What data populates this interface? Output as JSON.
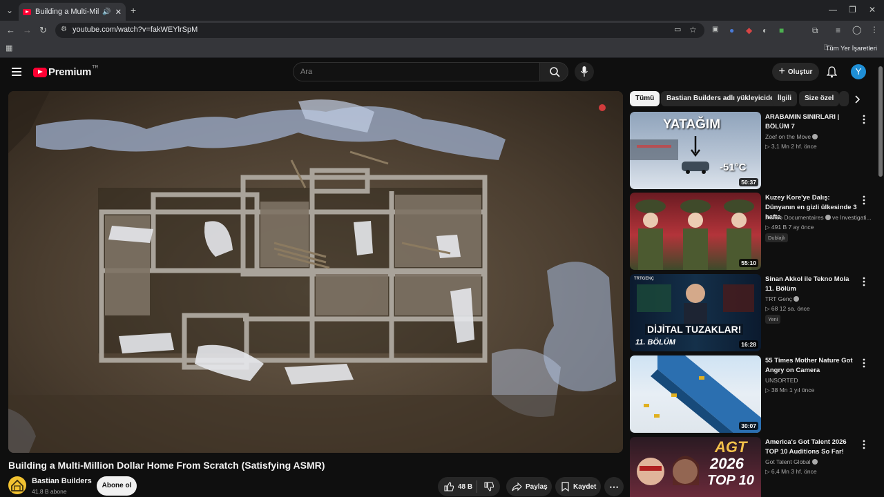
{
  "browser": {
    "tab_title": "Building a Multi-Million Dollar Home",
    "url": "youtube.com/watch?v=fakWEYlrSpM",
    "bookmarks_label": "Tüm Yer İşaretleri"
  },
  "header": {
    "logo_text": "Premium",
    "logo_region": "TR",
    "search_placeholder": "Ara",
    "create_label": "Oluştur",
    "avatar_letter": "Y"
  },
  "video": {
    "title": "Building a Multi-Million Dollar Home From Scratch (Satisfying ASMR)",
    "channel": "Bastian Builders",
    "subscribers": "41,8 B abone",
    "subscribe_label": "Abone ol",
    "likes": "48 B",
    "share_label": "Paylaş",
    "save_label": "Kaydet"
  },
  "chips": [
    "Tümü",
    "Bastian Builders adlı yükleyiciden",
    "İlgili",
    "Size özel"
  ],
  "recommendations": [
    {
      "title": "ARABAMIN SINIRLARI | BÖLÜM 7",
      "channel": "Zoef on the Move",
      "verified": true,
      "meta": "▷ 3,1 Mn  2 hf. önce",
      "badge": "",
      "duration": "50:37",
      "thumb_text_1": "YATAĞIM",
      "thumb_text_2": "-51°C"
    },
    {
      "title": "Kuzey Kore'ye Dalış: Dünyanın en gizli ülkesinde 3 hafta",
      "channel": "imineo Documentaires",
      "verified": true,
      "channel_extra": "ve Investigati...",
      "meta": "▷ 491 B  7 ay önce",
      "badge": "Dublajlı",
      "duration": "55:10"
    },
    {
      "title": "Sinan Akkol ile Tekno Mola 11. Bölüm",
      "channel": "TRT Genç",
      "verified": true,
      "meta": "▷ 68  12 sa. önce",
      "badge": "Yeni",
      "duration": "16:28",
      "thumb_text_1": "DİJİTAL TUZAKLAR!",
      "thumb_text_2": "11. BÖLÜM",
      "thumb_text_3": "TRTGENÇ"
    },
    {
      "title": "55 Times Mother Nature Got Angry on Camera",
      "channel": "UNSORTED",
      "verified": false,
      "meta": "▷ 38 Mn  1 yıl önce",
      "badge": "",
      "duration": "30:07"
    },
    {
      "title": "America's Got Talent 2026 TOP 10 Auditions So Far!",
      "channel": "Got Talent Global",
      "verified": true,
      "meta": "▷ 6,4 Mn  3 hf. önce",
      "badge": "",
      "duration": "",
      "thumb_text_1": "AGT",
      "thumb_text_2": "2026",
      "thumb_text_3": "TOP 10"
    }
  ],
  "colors": {
    "background": "#0f0f0f",
    "youtube_red": "#ff0033",
    "surface": "#272727",
    "avatar": "#1f8fd6"
  }
}
